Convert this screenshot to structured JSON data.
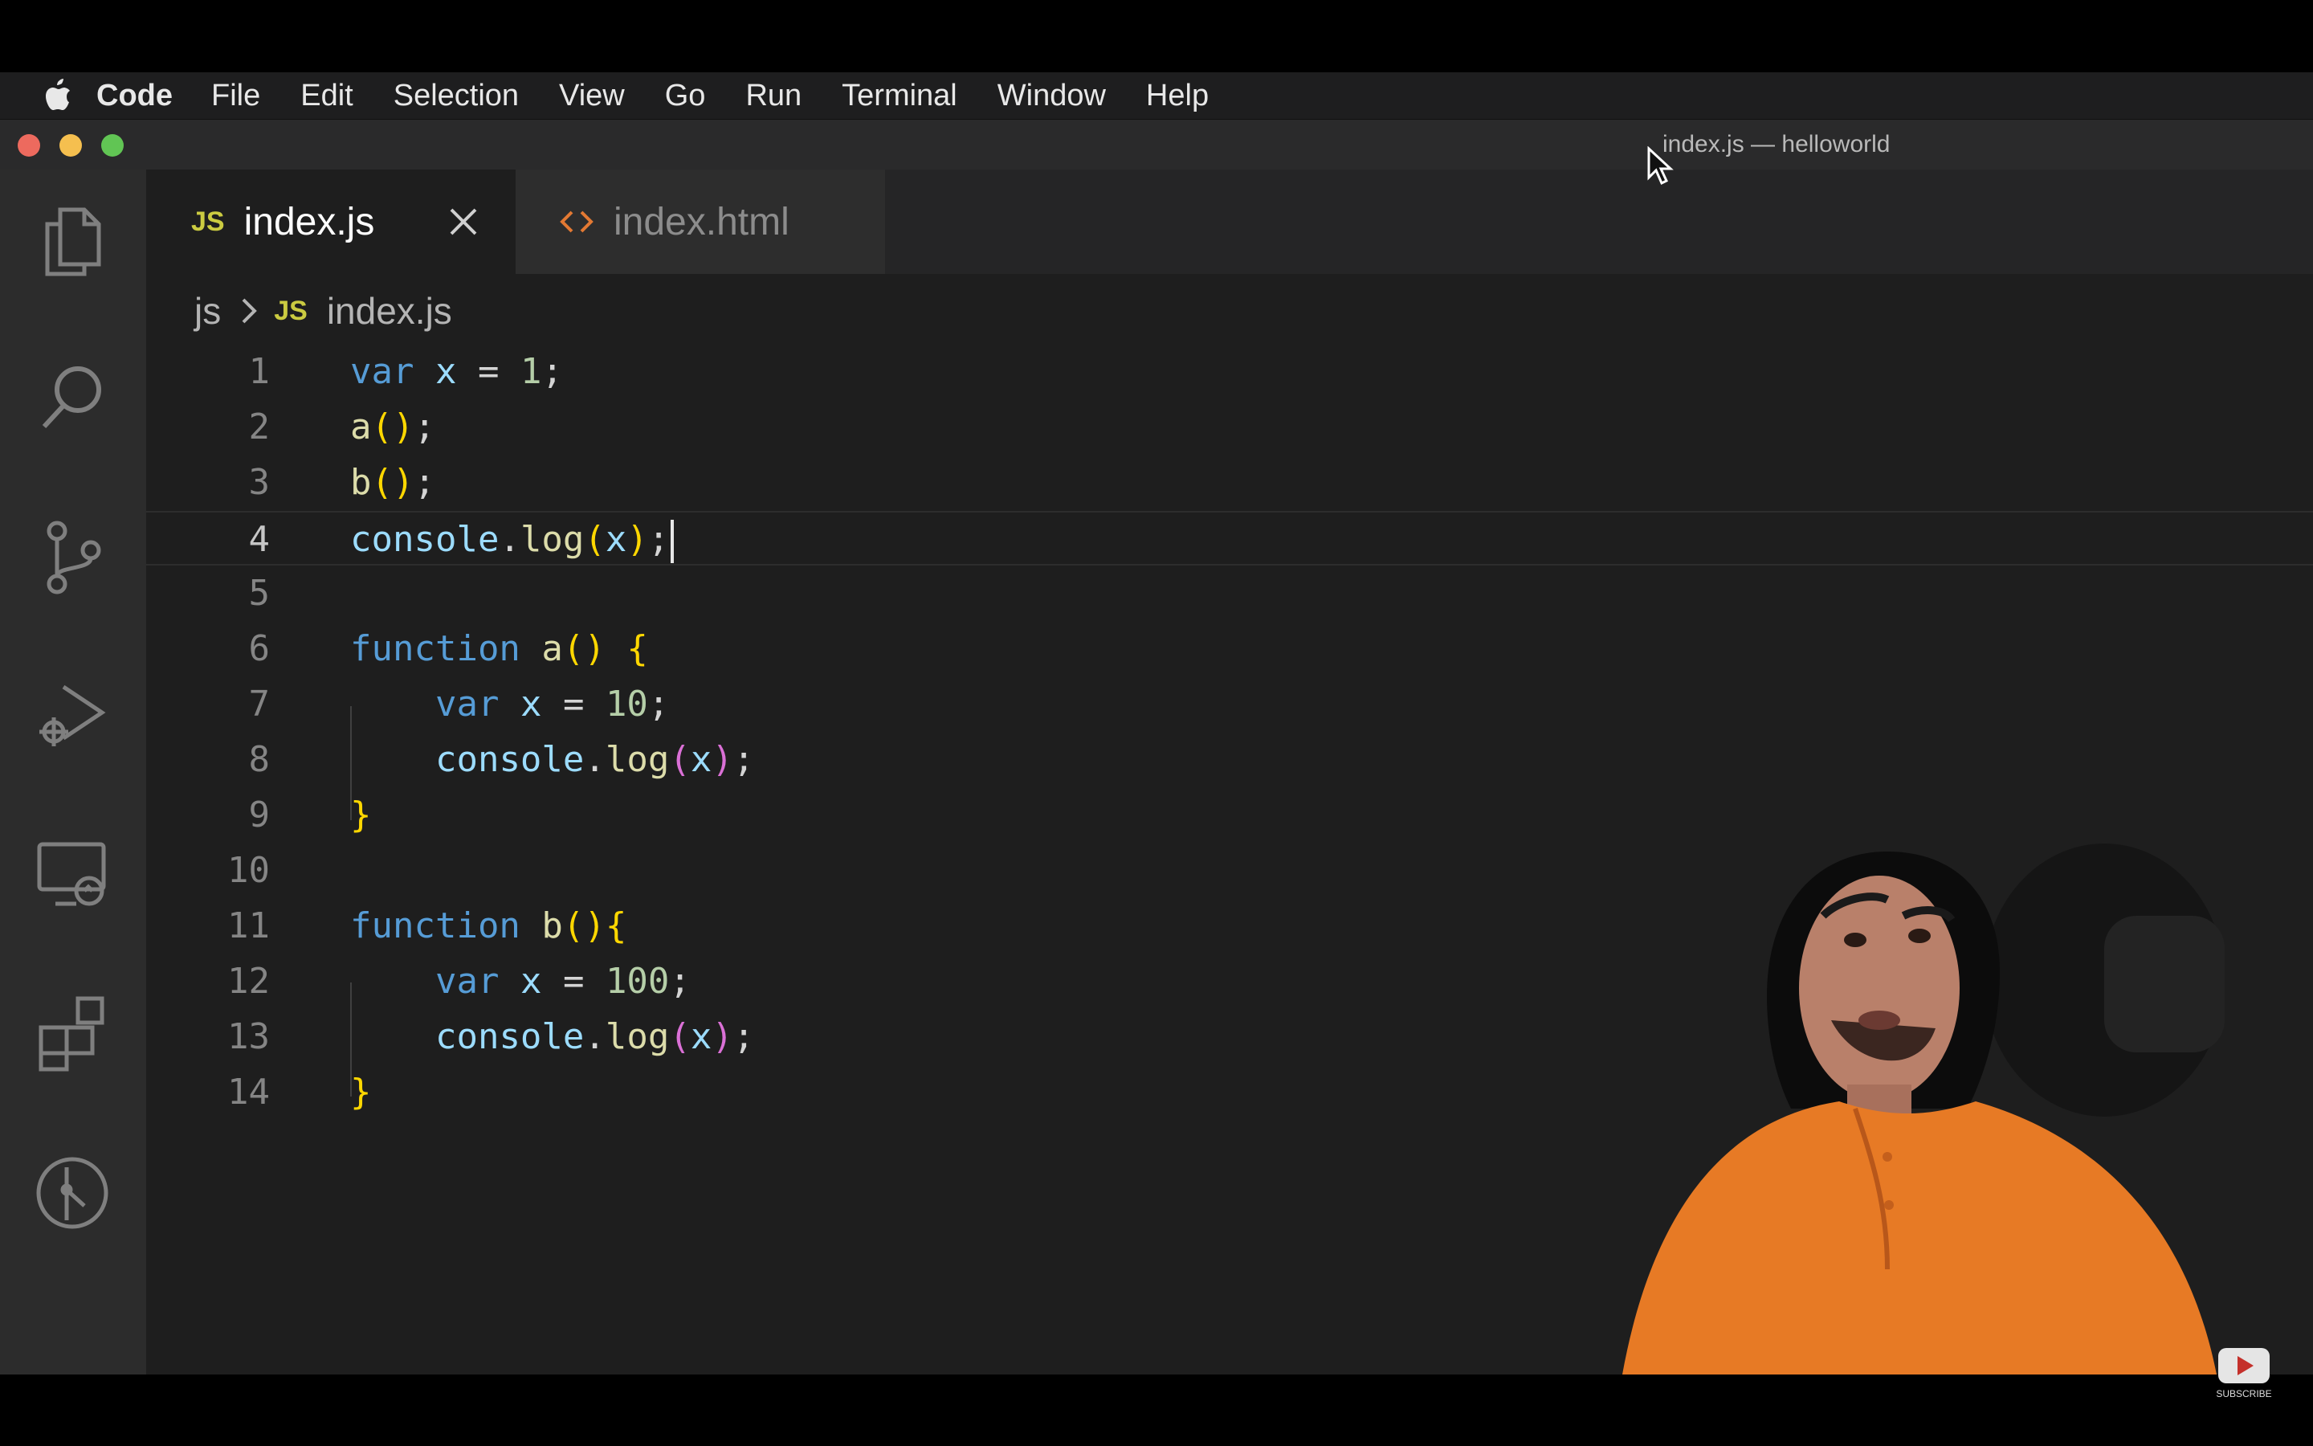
{
  "menubar": {
    "app": "Code",
    "items": [
      "File",
      "Edit",
      "Selection",
      "View",
      "Go",
      "Run",
      "Terminal",
      "Window",
      "Help"
    ]
  },
  "window": {
    "title": "index.js — helloworld"
  },
  "tabs": [
    {
      "badge": "JS",
      "label": "index.js",
      "active": true
    },
    {
      "label": "index.html",
      "active": false
    }
  ],
  "breadcrumb": {
    "folder": "js",
    "file_badge": "JS",
    "file": "index.js"
  },
  "code": {
    "lines": [
      "1",
      "2",
      "3",
      "4",
      "5",
      "6",
      "7",
      "8",
      "9",
      "10",
      "11",
      "12",
      "13",
      "14"
    ],
    "current_line": 4
  },
  "webcam": {
    "badge": "SUBSCRIBE"
  },
  "colors": {
    "keyword": "#569cd6",
    "identifier": "#9cdcfe",
    "number": "#b5cea8",
    "function": "#dcdcaa",
    "bracket_gold": "#ffd700",
    "bracket_purple": "#da70d6",
    "js_badge": "#cbcb41"
  }
}
